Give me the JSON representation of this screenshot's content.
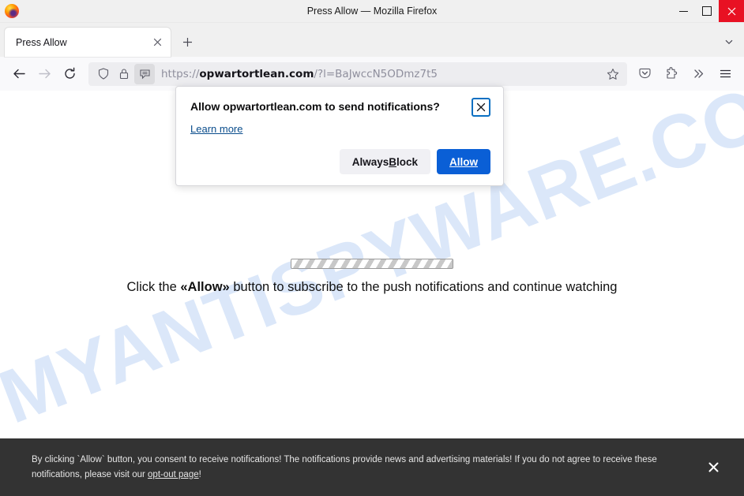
{
  "window": {
    "title": "Press Allow — Mozilla Firefox",
    "logo_icon": "firefox-logo",
    "minimize_label": "Minimize",
    "maximize_label": "Maximize",
    "close_label": "Close"
  },
  "tabstrip": {
    "tab_title": "Press Allow",
    "tab_close_icon": "close-icon",
    "new_tab_icon": "plus-icon",
    "list_all_tabs_icon": "chevron-down-icon"
  },
  "navbar": {
    "back_icon": "arrow-left-icon",
    "forward_icon": "arrow-right-icon",
    "reload_icon": "reload-icon",
    "shield_icon": "shield-icon",
    "lock_icon": "lock-icon",
    "permission_icon": "notification-bubble-icon",
    "url_scheme": "https://",
    "url_domain": "opwartortlean.com",
    "url_path": "/?l=BaJwccN5ODmz7t5",
    "url_full": "https://opwartortlean.com/?l=BaJwccN5ODmz7t5",
    "bookmark_icon": "star-icon",
    "pocket_icon": "pocket-icon",
    "extensions_icon": "puzzle-piece-icon",
    "overflow_icon": "double-chevron-right-icon",
    "menu_icon": "hamburger-menu-icon"
  },
  "doorhanger": {
    "title": "Allow opwartortlean.com to send notifications?",
    "close_icon": "close-icon",
    "learn_more": "Learn more",
    "block_button": "Always Block",
    "block_accesskey": "B",
    "allow_button": "Allow",
    "allow_accesskey": "A",
    "primary_color": "#0a5fd6",
    "secondary_color": "#f0f0f4"
  },
  "page": {
    "watermark": "MYANTISPYWARE.COM",
    "watermark_color": "#cfe0f7",
    "loader_icon": "striped-progress-bar",
    "instruction_prefix": "Click the ",
    "instruction_bold": "«Allow»",
    "instruction_suffix": " button to subscribe to the push notifications and continue watching"
  },
  "banner": {
    "text_part1": "By clicking `Allow` button, you consent to receive notifications! The notifications provide news and advertising materials! If you do not agree to receive these notifications, please visit our ",
    "link": "opt-out page",
    "text_part2": "!",
    "close_icon": "close-icon",
    "background_color": "#333333"
  }
}
